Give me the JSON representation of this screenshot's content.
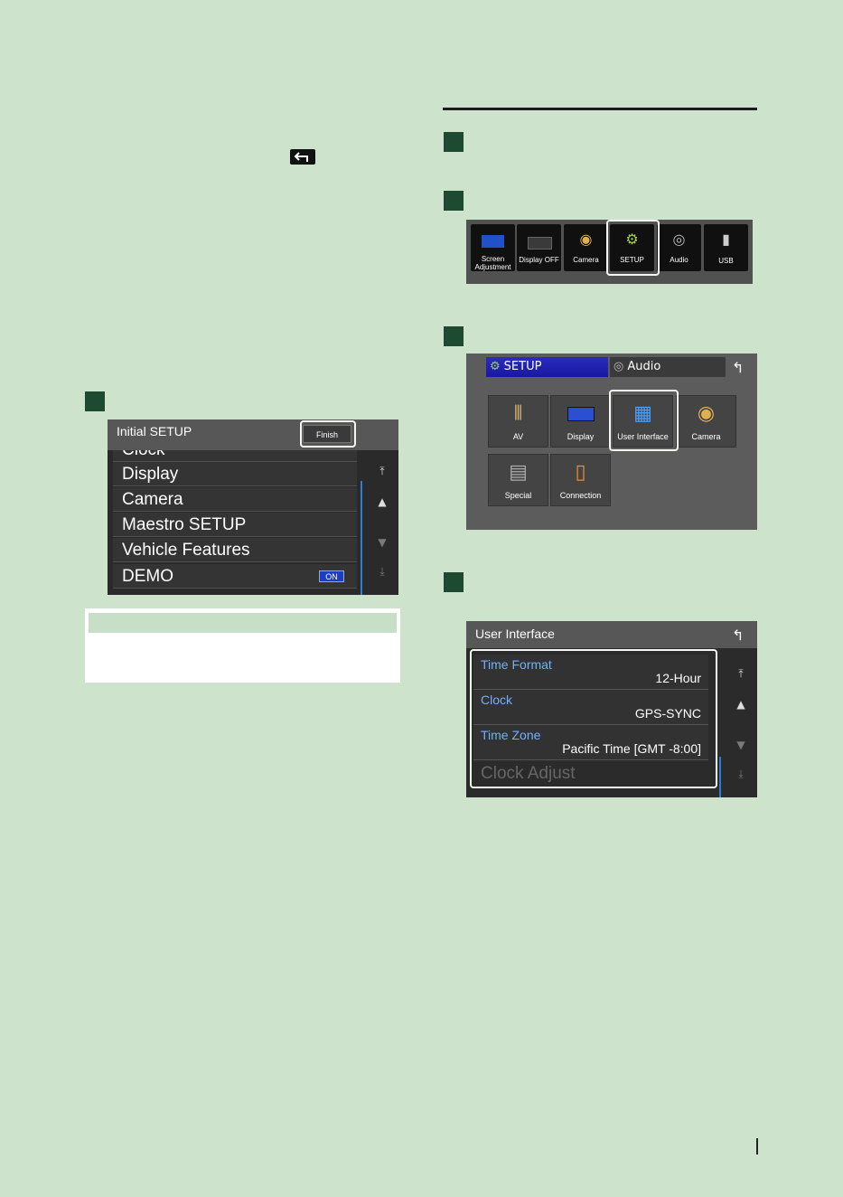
{
  "initial_setup": {
    "title": "Initial SETUP",
    "finish_label": "Finish",
    "items": [
      "Clock",
      "Display",
      "Camera",
      "Maestro SETUP",
      "Vehicle Features",
      "DEMO"
    ],
    "demo_badge": "ON"
  },
  "home_strip": {
    "tiles": [
      {
        "label": "Screen Adjustment",
        "icon": "screen-adjust-icon"
      },
      {
        "label": "Display OFF",
        "icon": "display-off-icon"
      },
      {
        "label": "Camera",
        "icon": "camera-icon"
      },
      {
        "label": "SETUP",
        "icon": "gear-icon"
      },
      {
        "label": "Audio",
        "icon": "speaker-icon"
      },
      {
        "label": "USB",
        "icon": "usb-icon"
      }
    ]
  },
  "setup_menu": {
    "tabs": [
      "SETUP",
      "Audio"
    ],
    "tiles": [
      "AV",
      "Display",
      "User Interface",
      "Camera",
      "Special",
      "Connection"
    ]
  },
  "user_interface": {
    "title": "User Interface",
    "items": [
      {
        "label": "Time Format",
        "value": "12-Hour"
      },
      {
        "label": "Clock",
        "value": "GPS-SYNC"
      },
      {
        "label": "Time Zone",
        "value": "Pacific Time [GMT -8:00]"
      }
    ],
    "faded_item": "Clock Adjust"
  },
  "colors": {
    "page_bg": "#cde3cc",
    "step_marker": "#1d4a30",
    "accent_blue": "#6fb1ff",
    "tab_active": "#2b2bbf"
  }
}
